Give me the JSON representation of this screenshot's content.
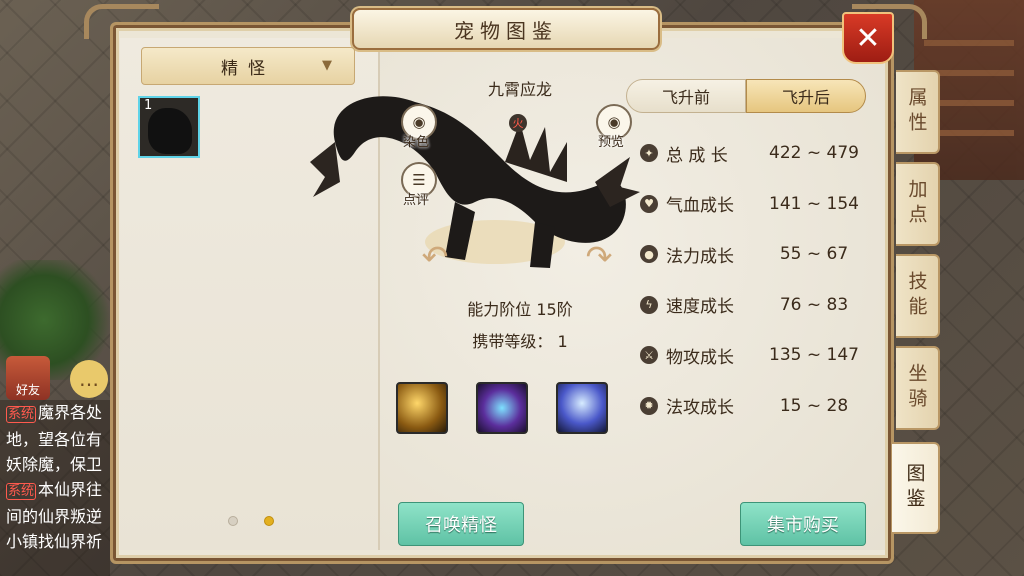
{
  "window": {
    "title": "宠物图鉴",
    "close_label": "✕"
  },
  "side_tabs": [
    {
      "label": "属性",
      "active": false
    },
    {
      "label": "加点",
      "active": false
    },
    {
      "label": "技能",
      "active": false
    },
    {
      "label": "坐骑",
      "active": false
    },
    {
      "label": "图鉴",
      "active": true
    }
  ],
  "category": {
    "selected": "精怪",
    "arrow": "▼"
  },
  "pet_list": [
    {
      "index_label": "1",
      "selected": true
    }
  ],
  "page_dots": {
    "count": 2,
    "current": 2
  },
  "pet": {
    "name": "九霄应龙",
    "element_label": "火",
    "dye_label": "染色",
    "preview_label": "预览",
    "comment_label": "点评",
    "ability_rank": "能力阶位 15阶",
    "carry_level": "携带等级： 1"
  },
  "stage_tabs": [
    {
      "label": "飞升前",
      "active": false
    },
    {
      "label": "飞升后",
      "active": true
    }
  ],
  "stats": [
    {
      "icon": "growth-icon",
      "name": "总 成 长",
      "value": "422 ~ 479"
    },
    {
      "icon": "hp-icon",
      "name": "气血成长",
      "value": "141 ~ 154"
    },
    {
      "icon": "mana-icon",
      "name": "法力成长",
      "value": "55 ~ 67"
    },
    {
      "icon": "speed-icon",
      "name": "速度成长",
      "value": "76 ~ 83"
    },
    {
      "icon": "physical-attack-icon",
      "name": "物攻成长",
      "value": "135 ~ 147"
    },
    {
      "icon": "magic-attack-icon",
      "name": "法攻成长",
      "value": "15 ~ 28"
    }
  ],
  "buttons": {
    "summon": "召唤精怪",
    "market": "集市购买"
  },
  "friend_label": "好友",
  "chat": {
    "lines": [
      {
        "tag": "系统",
        "text": "魔界各处"
      },
      {
        "tag": "",
        "text": "地，望各位有"
      },
      {
        "tag": "",
        "text": "妖除魔，保卫"
      },
      {
        "tag": "系统",
        "text": "本仙界往"
      },
      {
        "tag": "",
        "text": "间的仙界叛逆"
      },
      {
        "tag": "",
        "text": "小镇找仙界祈"
      }
    ]
  }
}
